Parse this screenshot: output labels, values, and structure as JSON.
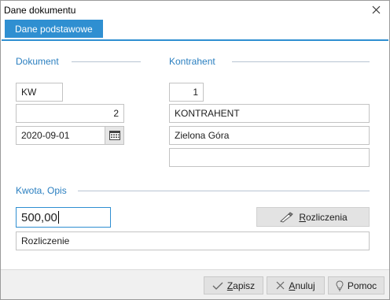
{
  "window": {
    "title": "Dane dokumentu"
  },
  "tabs": [
    {
      "label": "Dane podstawowe",
      "active": true
    }
  ],
  "dokument": {
    "heading": "Dokument",
    "symbol": "KW",
    "number": "2",
    "date": "2020-09-01"
  },
  "kontrahent": {
    "heading": "Kontrahent",
    "id": "1",
    "name": "KONTRAHENT",
    "city": "Zielona Góra",
    "extra": ""
  },
  "kwota": {
    "heading": "Kwota, Opis",
    "amount": "500,00",
    "description": "Rozliczenie",
    "rozliczenia_button": {
      "accel": "R",
      "rest": "ozliczenia",
      "icon": "pencil-ruler-icon"
    }
  },
  "footer": {
    "save": {
      "accel": "Z",
      "rest": "apisz",
      "icon": "check-icon"
    },
    "cancel": {
      "accel": "A",
      "rest": "nuluj",
      "icon": "x-icon"
    },
    "help": {
      "label": "Pomoc",
      "icon": "lightbulb-icon"
    }
  },
  "colors": {
    "accent": "#2f8fd1",
    "section_heading": "#2a7fc0"
  }
}
